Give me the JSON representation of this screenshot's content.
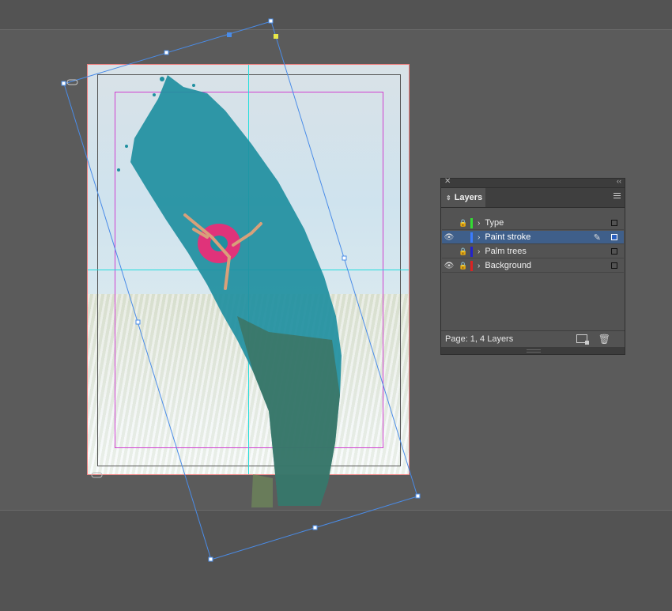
{
  "layers_panel": {
    "tab_label": "Layers",
    "status": "Page: 1, 4 Layers",
    "close_glyph": "✕",
    "collapse_glyph": "‹‹",
    "layers": [
      {
        "name": "Type",
        "visible": false,
        "locked": true,
        "color": "#33dd33",
        "selected": false,
        "editing": false
      },
      {
        "name": "Paint stroke",
        "visible": true,
        "locked": false,
        "color": "#3b7cff",
        "selected": true,
        "editing": true
      },
      {
        "name": "Palm trees",
        "visible": false,
        "locked": true,
        "color": "#2222cc",
        "selected": false,
        "editing": false
      },
      {
        "name": "Background",
        "visible": true,
        "locked": true,
        "color": "#dd2222",
        "selected": false,
        "editing": false
      }
    ]
  },
  "icons": {
    "eye": "👁",
    "lock": "🔒",
    "chevron": "›",
    "pen": "✎",
    "trash": "🗑"
  },
  "colors": {
    "guide_cyan": "#22dddd",
    "margin_magenta": "#d040d0",
    "bleed_red": "#f08080",
    "selection_blue": "#4a8ce8",
    "paint_teal": "#1f8fa0"
  }
}
